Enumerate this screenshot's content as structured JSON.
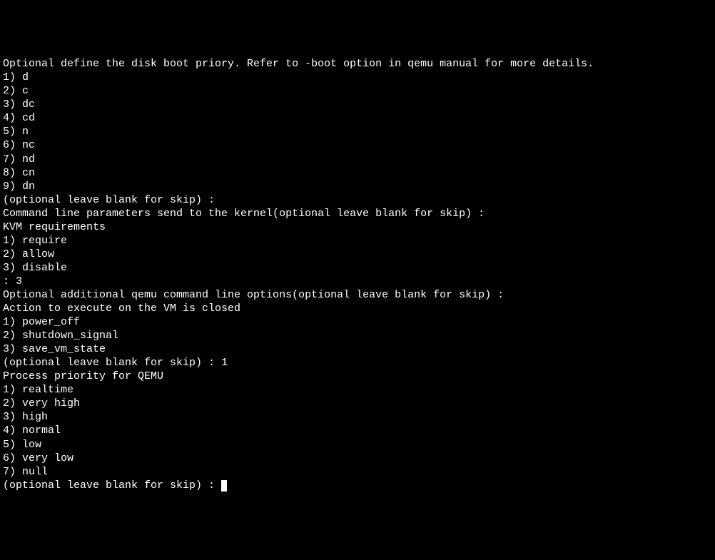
{
  "terminal": {
    "boot_priority": {
      "header": "Optional define the disk boot priory. Refer to -boot option in qemu manual for more details.",
      "opt1": "1) d",
      "opt2": "2) c",
      "opt3": "3) dc",
      "opt4": "4) cd",
      "opt5": "5) n",
      "opt6": "6) nc",
      "opt7": "7) nd",
      "opt8": "8) cn",
      "opt9": "9) dn",
      "prompt": "(optional leave blank for skip) :"
    },
    "kernel_params": {
      "prompt": "Command line parameters send to the kernel(optional leave blank for skip) :"
    },
    "kvm": {
      "header": "KVM requirements",
      "opt1": "1) require",
      "opt2": "2) allow",
      "opt3": "3) disable",
      "prompt": ": 3"
    },
    "blank1": "",
    "qemu_options": {
      "prompt": "Optional additional qemu command line options(optional leave blank for skip) :"
    },
    "close_action": {
      "header": "Action to execute on the VM is closed",
      "opt1": "1) power_off",
      "opt2": "2) shutdown_signal",
      "opt3": "3) save_vm_state",
      "prompt": "(optional leave blank for skip) : 1"
    },
    "blank2": "",
    "process_priority": {
      "header": "Process priority for QEMU",
      "opt1": "1) realtime",
      "opt2": "2) very high",
      "opt3": "3) high",
      "opt4": "4) normal",
      "opt5": "5) low",
      "opt6": "6) very low",
      "opt7": "7) null",
      "prompt": "(optional leave blank for skip) : "
    }
  }
}
